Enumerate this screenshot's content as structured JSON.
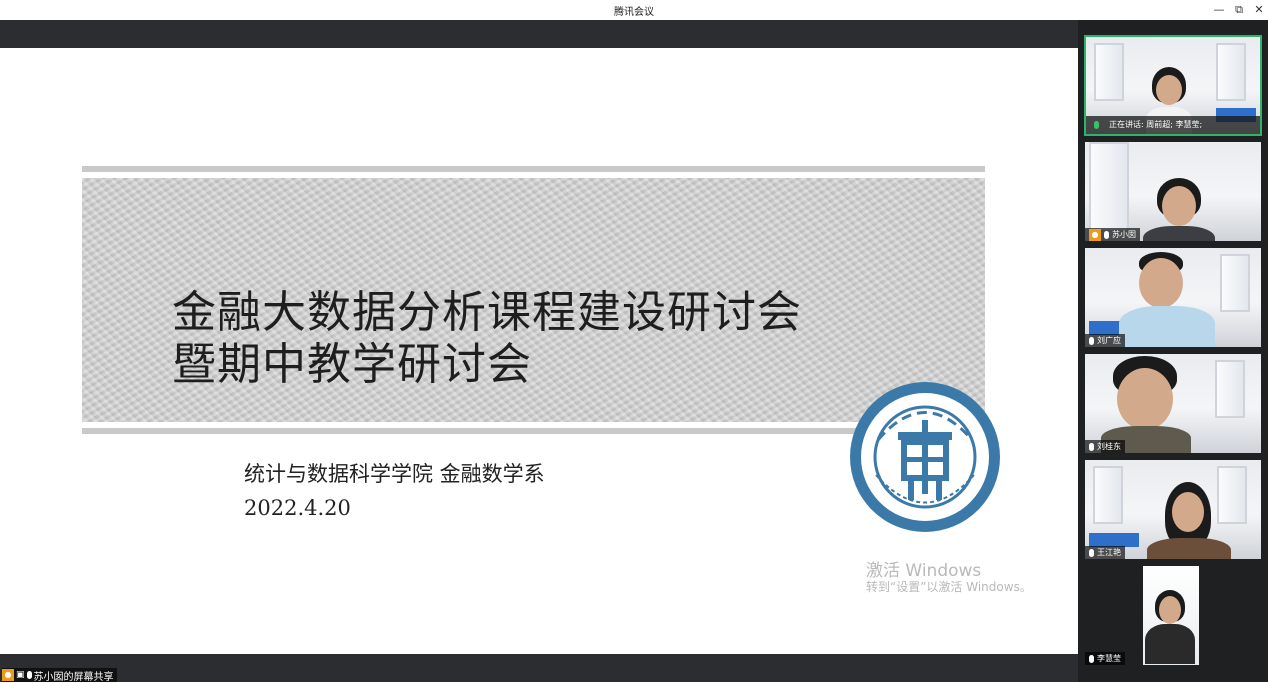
{
  "window": {
    "title": "腾讯会议"
  },
  "window_controls": {
    "minimize": "—",
    "restore": "⧉",
    "close": "✕"
  },
  "slide": {
    "title_line1": "金融大数据分析课程建设研讨会",
    "title_line2": "暨期中教学研讨会",
    "department": "统计与数据科学学院  金融数学系",
    "date": "2022.4.20"
  },
  "watermark": {
    "line1": "激活 Windows",
    "line2": "转到“设置”以激活 Windows。"
  },
  "share_status": {
    "label": "苏小囡的屏幕共享"
  },
  "speaking": {
    "label": "正在讲话: 周前超; 李慧莹;"
  },
  "participants": [
    {
      "name": "",
      "speaking": true,
      "host": false
    },
    {
      "name": "苏小囡",
      "speaking": false,
      "host": true
    },
    {
      "name": "刘广应",
      "speaking": false,
      "host": false
    },
    {
      "name": "刘桂东",
      "speaking": false,
      "host": false
    },
    {
      "name": "王江艳",
      "speaking": false,
      "host": false
    },
    {
      "name": "李慧莹",
      "speaking": false,
      "host": false
    }
  ],
  "colors": {
    "speaking_border": "#2fb36a",
    "host_badge": "#f09a1a",
    "seal_blue": "#3b7aa8"
  }
}
